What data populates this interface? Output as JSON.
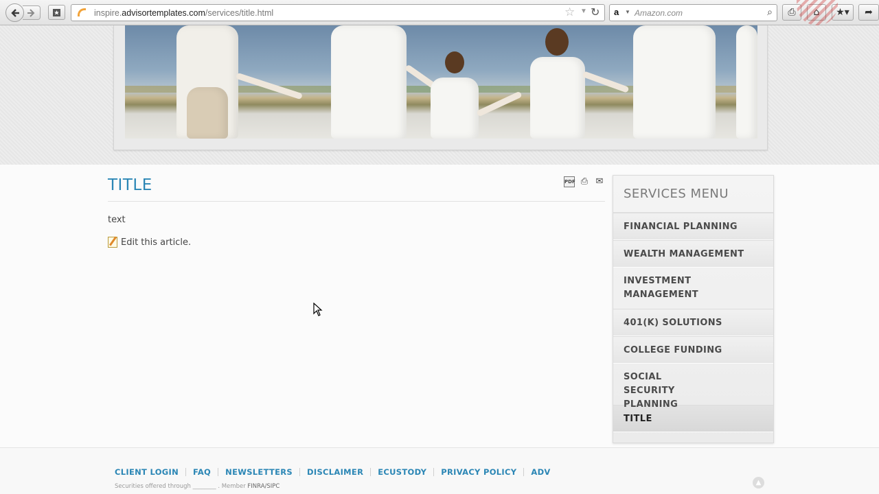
{
  "browser": {
    "url_prefix": "inspire.",
    "url_domain": "advisortemplates.com",
    "url_path": "/services/title.html",
    "search_engine_logo": "a",
    "search_placeholder": "Amazon.com",
    "icons": [
      "back-arrow-icon",
      "forward-arrow-icon",
      "pin-icon",
      "bookmark-star-icon",
      "reload-icon",
      "search-icon",
      "print-icon",
      "home-icon",
      "bookmarks-icon",
      "menu-icon"
    ]
  },
  "article": {
    "title": "TITLE",
    "body": "text",
    "edit_label": "Edit this article.",
    "tools": [
      "pdf-icon",
      "print-icon",
      "email-icon"
    ]
  },
  "services_menu": {
    "heading": "SERVICES MENU",
    "items": [
      {
        "label": "FINANCIAL PLANNING"
      },
      {
        "label": "WEALTH MANAGEMENT"
      },
      {
        "label": "INVESTMENT MANAGEMENT"
      },
      {
        "label": "401(K) SOLUTIONS"
      },
      {
        "label": "COLLEGE FUNDING"
      },
      {
        "label": "SOCIAL SECURITY PLANNING"
      },
      {
        "label": "TITLE"
      }
    ],
    "active": "TITLE"
  },
  "footer": {
    "links": [
      {
        "label": "CLIENT LOGIN"
      },
      {
        "label": "FAQ"
      },
      {
        "label": "NEWSLETTERS"
      },
      {
        "label": "DISCLAIMER"
      },
      {
        "label": "ECUSTODY"
      },
      {
        "label": "PRIVACY POLICY"
      },
      {
        "label": "ADV"
      }
    ],
    "fine_print_prefix": "Securities offered through ________ . Member ",
    "fine_print_finra": "FINRA",
    "fine_print_sep": "/",
    "fine_print_sipc": "SIPC"
  },
  "colors": {
    "accent": "#2b86b5",
    "menu_text": "#4a4a4a"
  }
}
